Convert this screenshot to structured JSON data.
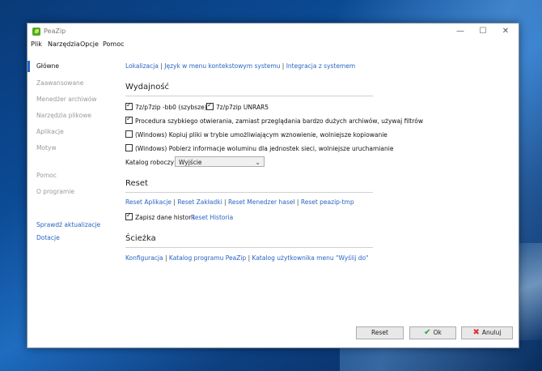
{
  "window": {
    "title": "PeaZip"
  },
  "window_controls": {
    "minimize": "—",
    "maximize": "☐",
    "close": "✕"
  },
  "menu": [
    "Plik",
    "Narzędzia",
    "Opcje",
    "Pomoc"
  ],
  "sidebar": {
    "items": [
      {
        "label": "Główne",
        "active": true
      },
      {
        "label": "Zaawansowane"
      },
      {
        "label": "Menedżer archiwów"
      },
      {
        "label": "Narzędzia plikowe"
      },
      {
        "label": "Aplikacje"
      },
      {
        "label": "Motyw"
      },
      {
        "label": "Pomoc"
      },
      {
        "label": "O programie"
      },
      {
        "label": "Sprawdź aktualizacje",
        "link": true
      },
      {
        "label": "Dotacje",
        "link": true
      }
    ]
  },
  "top_links": {
    "l1": "Lokalizacja",
    "l2": "Język w menu kontekstowym systemu",
    "l3": "Integracja z systemem",
    "sep": " | "
  },
  "performance": {
    "title": "Wydajność",
    "opt1": "7z/p7zip -bb0 (szybsze)",
    "opt2": "7z/p7zip UNRAR5",
    "opt3": "Procedura szybkiego otwierania, zamiast przeglądania bardzo dużych archiwów, używaj filtrów",
    "opt4": "(Windows) Kopiuj pliki w trybie umożliwiającym wznowienie, wolniejsze kopiowanie",
    "opt5": "(Windows) Pobierz informacje woluminu dla jednostek sieci, wolniejsze uruchamianie",
    "workdir_label": "Katalog roboczy",
    "workdir_value": "Wyjście"
  },
  "reset": {
    "title": "Reset",
    "l1": "Reset Aplikacje",
    "l2": "Reset Zakładki",
    "l3": "Reset Menedzer haseł",
    "l4": "Reset peazip-tmp",
    "save_history": "Zapisz dane historii",
    "reset_history": "Reset Historia"
  },
  "path": {
    "title": "Ścieżka",
    "l1": "Konfiguracja",
    "l2": "Katalog programu PeaZip",
    "l3": "Katalog użytkownika menu \"Wyślij do\""
  },
  "buttons": {
    "reset": "Reset",
    "ok": "Ok",
    "cancel": "Anuluj",
    "ok_glyph": "✔",
    "cancel_glyph": "✖"
  }
}
